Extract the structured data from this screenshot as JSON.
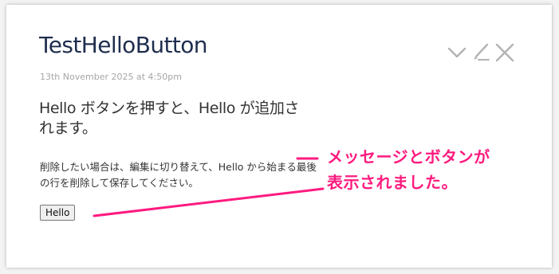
{
  "card": {
    "title": "TestHelloButton",
    "timestamp": "13th November 2025 at 4:50pm",
    "lead": "Hello ボタンを押すと、Hello が追加されます。",
    "description": "削除したい場合は、編集に切り替えて、Hello から始まる最後の行を削除して保存してください。",
    "button_label": "Hello"
  },
  "toolbar": {
    "icons": [
      "chevron-down-icon",
      "edit-icon",
      "close-icon"
    ]
  },
  "annotation": {
    "line1": "メッセージとボタンが",
    "line2": "表示されました。",
    "color": "#ff1a7f"
  }
}
